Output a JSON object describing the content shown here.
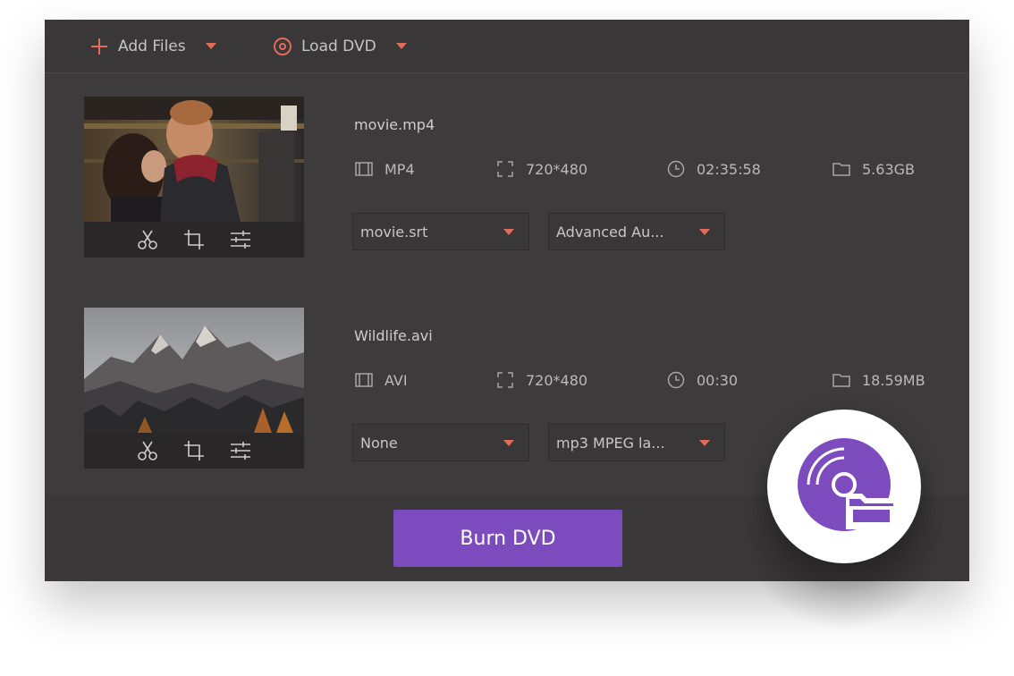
{
  "toolbar": {
    "add_files_label": "Add Files",
    "load_dvd_label": "Load DVD"
  },
  "files": [
    {
      "name": "movie.mp4",
      "format": "MP4",
      "resolution": "720*480",
      "duration": "02:35:58",
      "size": "5.63GB",
      "subtitle": "movie.srt",
      "audio": "Advanced Au..."
    },
    {
      "name": "Wildlife.avi",
      "format": "AVI",
      "resolution": "720*480",
      "duration": "00:30",
      "size": "18.59MB",
      "subtitle": "None",
      "audio": "mp3 MPEG la..."
    }
  ],
  "footer": {
    "burn_label": "Burn DVD"
  },
  "icons": {
    "add": "plus-icon",
    "load": "disc-icon",
    "cut": "scissors-icon",
    "crop": "crop-icon",
    "effects": "sliders-icon",
    "format": "film-icon",
    "resolution": "fullscreen-icon",
    "duration": "clock-icon",
    "size": "folder-icon",
    "badge": "dvd-folder-icon"
  },
  "colors": {
    "accent_orange": "#e36b5a",
    "accent_purple": "#7c4bbd",
    "panel": "#3e3b3c"
  }
}
